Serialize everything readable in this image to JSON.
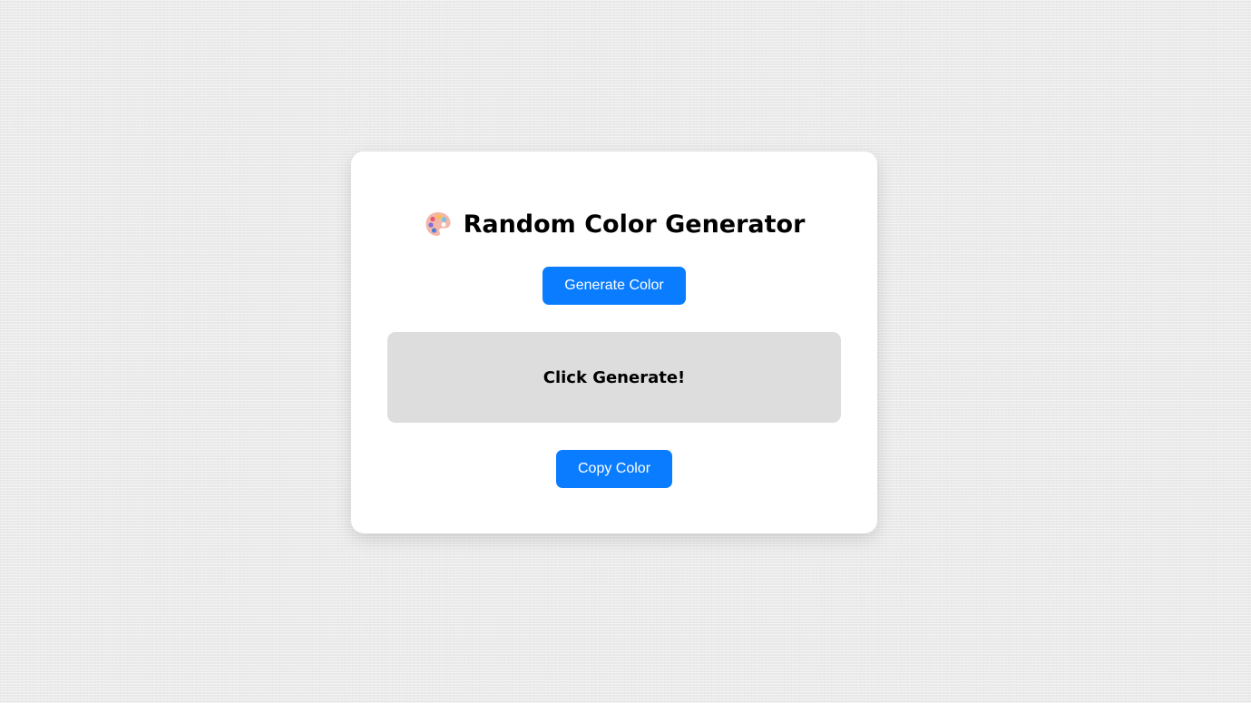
{
  "app": {
    "title": "Random Color Generator",
    "title_icon": "palette-icon"
  },
  "controls": {
    "generate_label": "Generate Color",
    "copy_label": "Copy Color"
  },
  "display": {
    "text": "Click Generate!",
    "background_color": "#dddddd"
  },
  "colors": {
    "button_background": "#0a7cff",
    "button_text": "#ffffff",
    "card_background": "#ffffff",
    "page_background": "#eeeeee"
  }
}
